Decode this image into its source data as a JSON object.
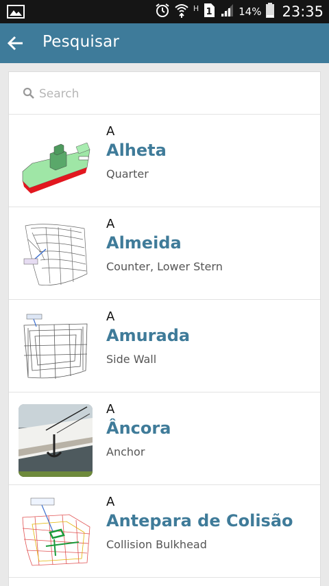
{
  "status_bar": {
    "battery_percent": "14%",
    "time": "23:35",
    "network_type": "H",
    "sim_slot": "1",
    "icons": [
      "image-icon",
      "alarm-icon",
      "wifi-icon",
      "sim-icon",
      "signal-icon",
      "battery-icon"
    ]
  },
  "toolbar": {
    "title": "Pesquisar",
    "back_icon": "arrow-left-icon",
    "color": "#3e7b9a"
  },
  "search": {
    "placeholder": "Search",
    "value": ""
  },
  "items": [
    {
      "letter": "A",
      "title": "Alheta",
      "subtitle": "Quarter",
      "thumb": "ship-quarter-diagram"
    },
    {
      "letter": "A",
      "title": "Almeida",
      "subtitle": "Counter, Lower Stern",
      "thumb": "stern-wireframe-diagram"
    },
    {
      "letter": "A",
      "title": "Amurada",
      "subtitle": "Side Wall",
      "thumb": "hull-section-diagram"
    },
    {
      "letter": "A",
      "title": "Âncora",
      "subtitle": "Anchor",
      "thumb": "anchor-photo"
    },
    {
      "letter": "A",
      "title": "Antepara de Colisão",
      "subtitle": "Collision Bulkhead",
      "thumb": "bow-bulkhead-diagram"
    }
  ],
  "colors": {
    "accent": "#3f7b99",
    "status_bar": "#151515",
    "background": "#e9e9e9"
  }
}
